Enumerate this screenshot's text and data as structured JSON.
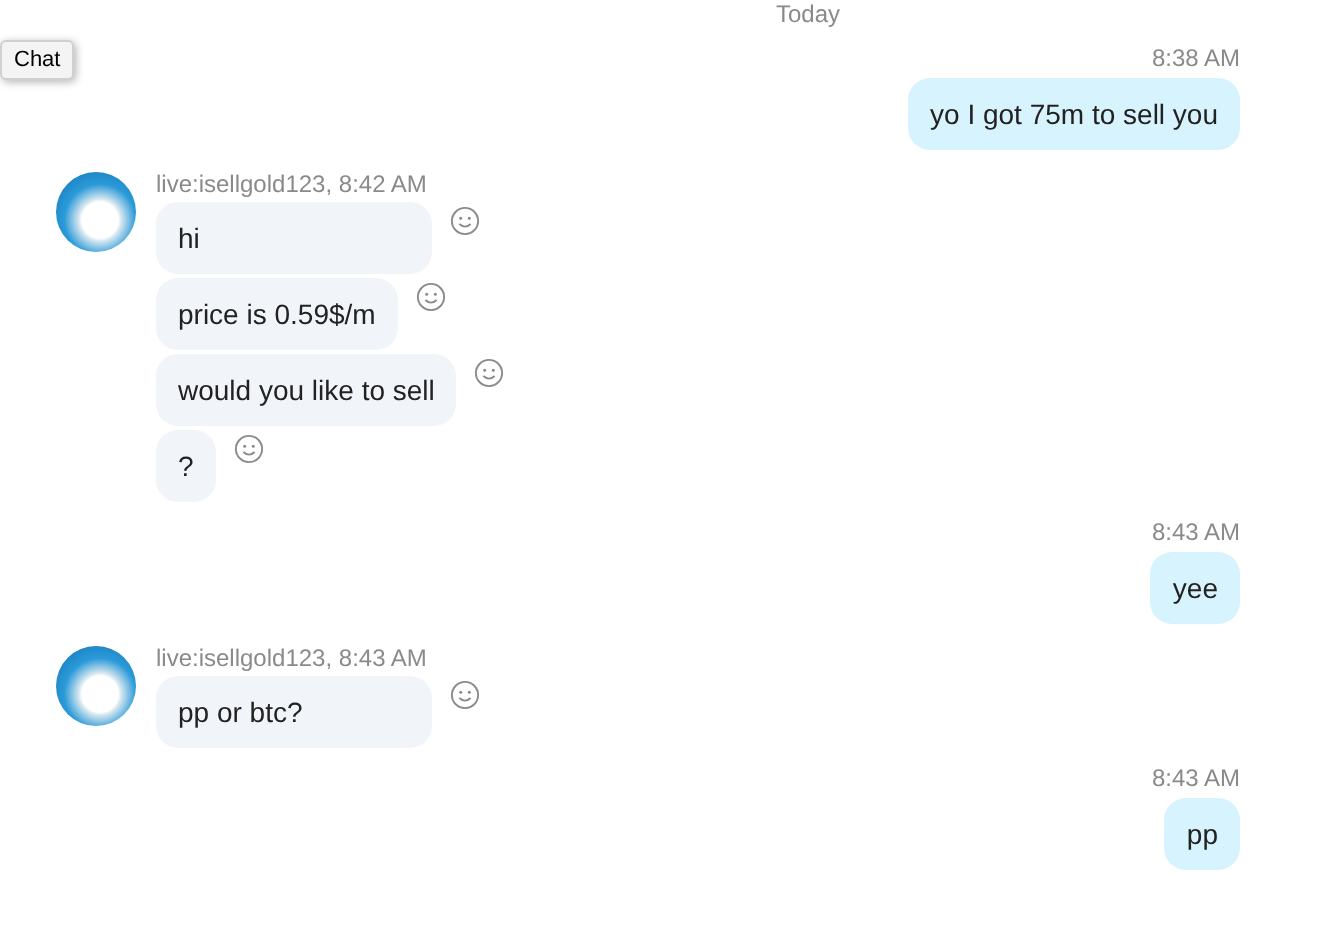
{
  "date_divider": "Today",
  "chat_button": "Chat",
  "messages": [
    {
      "kind": "outgoing",
      "time": "8:38 AM",
      "bubbles": [
        "yo I got 75m to sell you"
      ]
    },
    {
      "kind": "incoming",
      "sender": "live:isellgold123, 8:42 AM",
      "bubbles": [
        "hi",
        "price is 0.59$/m",
        "would you like to sell",
        "?"
      ]
    },
    {
      "kind": "outgoing",
      "time": "8:43 AM",
      "bubbles": [
        "yee"
      ]
    },
    {
      "kind": "incoming",
      "sender": "live:isellgold123, 8:43 AM",
      "bubbles": [
        "pp or btc?"
      ]
    },
    {
      "kind": "outgoing",
      "time": "8:43 AM",
      "bubbles": [
        "pp"
      ]
    }
  ]
}
